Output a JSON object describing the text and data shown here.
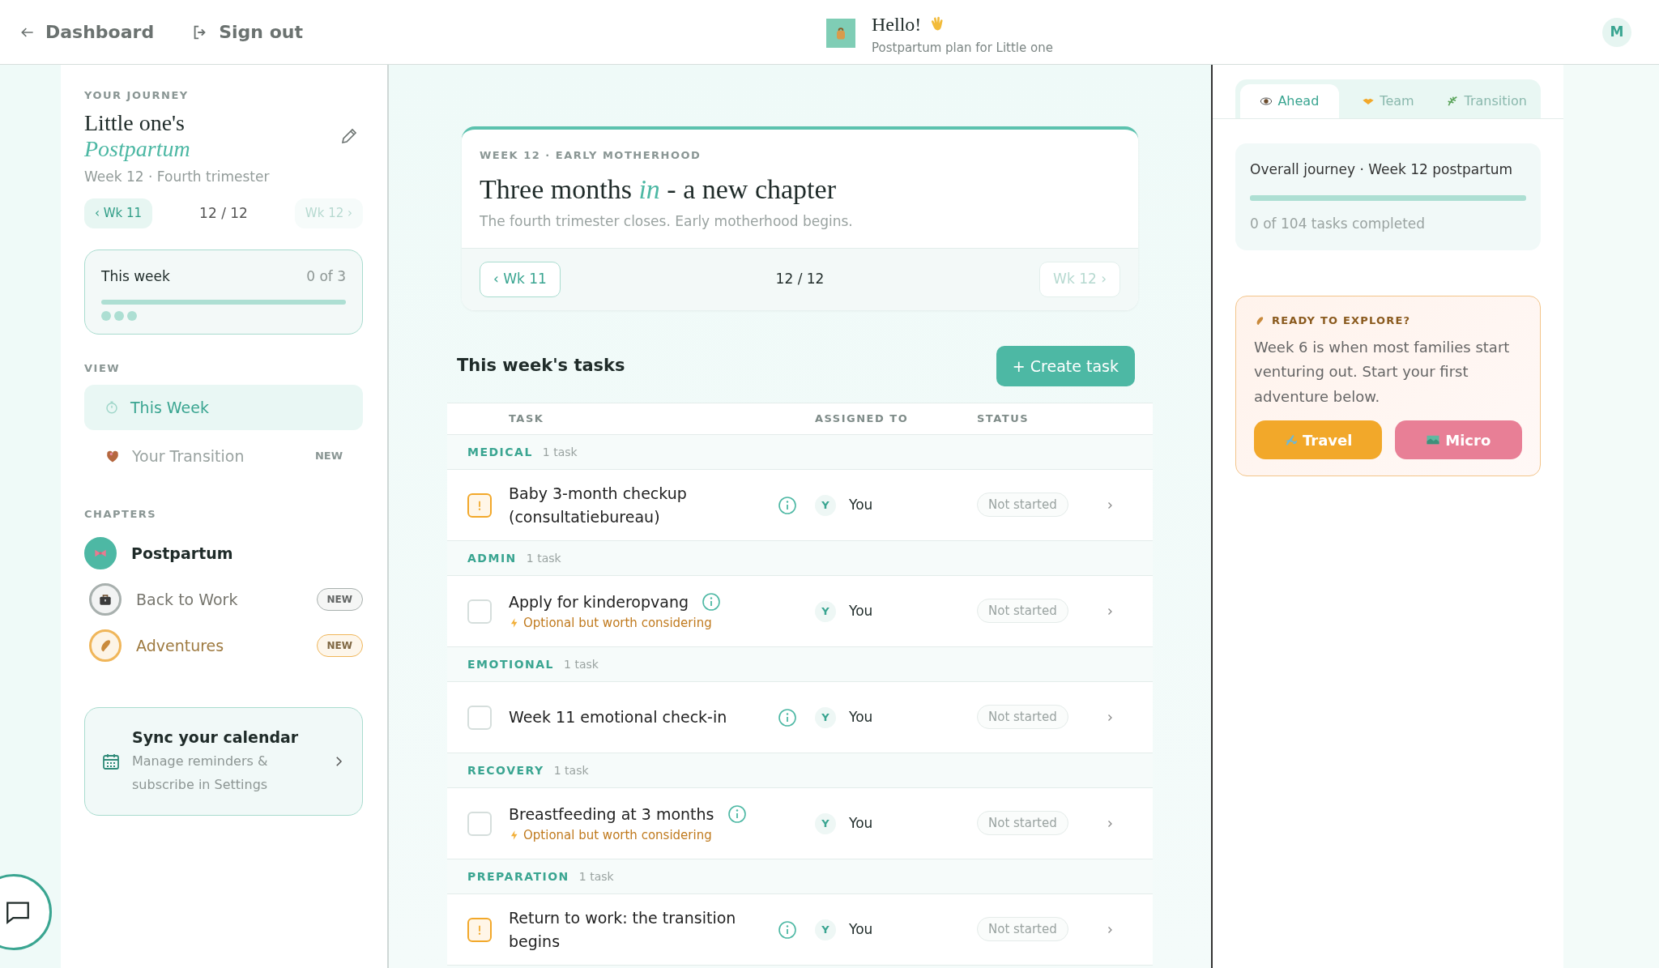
{
  "topbar": {
    "back_label": "Dashboard",
    "signout_label": "Sign out",
    "greeting": "Hello!",
    "subtitle": "Postpartum plan for Little one",
    "avatar_initial": "M"
  },
  "sidebar": {
    "section_label": "YOUR JOURNEY",
    "title": "Little one's",
    "title_accent": "Postpartum",
    "subtitle": "Week 12 · Fourth trimester",
    "prev": {
      "label": "‹ Wk 11",
      "disabled": false
    },
    "counter": "12 / 12",
    "next": {
      "label": "Wk 12 ›",
      "disabled": true
    },
    "this_week": {
      "label": "This week",
      "count": "0 of 3",
      "level": 0,
      "dots": [
        {
          "done": false
        },
        {
          "done": false
        },
        {
          "done": false
        }
      ]
    },
    "view_label": "VIEW",
    "views": [
      {
        "label": "This Week",
        "selected": true
      },
      {
        "label": "Your Transition",
        "selected": false,
        "badge": "NEW"
      }
    ],
    "chapters_label": "CHAPTERS",
    "chapters": [
      {
        "label": "Postpartum",
        "selected": true,
        "color": "#4db8a4"
      },
      {
        "label": "Back to Work",
        "selected": false,
        "badge": "NEW",
        "color": "#a8b0ae"
      },
      {
        "label": "Adventures",
        "selected": false,
        "badge": "NEW",
        "color": "#f0b65a"
      }
    ],
    "calendar": {
      "title": "Sync your calendar",
      "text": "Manage reminders & subscribe in Settings"
    }
  },
  "hero": {
    "eyebrow": "WEEK 12 · EARLY MOTHERHOOD",
    "title": "Three months *in* - a new chapter",
    "subtitle": "The fourth trimester closes. Early motherhood begins.",
    "prev": {
      "label": "‹ Wk 11",
      "disabled": false
    },
    "counter": "12 / 12",
    "next": {
      "label": "Wk 12 ›",
      "disabled": true
    }
  },
  "tasks": {
    "title": "This week's tasks",
    "create_label": "+ Create task",
    "columns": [
      "TASK",
      "ASSIGNED TO",
      "STATUS"
    ],
    "groups": [
      {
        "name": "MEDICAL",
        "count": "1 task",
        "tasks": [
          {
            "kind": "urgent",
            "title": "Baby 3-month checkup (consultatiebureau)",
            "assignee_initial": "Y",
            "assignee": "You",
            "status": "Not started"
          }
        ]
      },
      {
        "name": "ADMIN",
        "count": "1 task",
        "tasks": [
          {
            "kind": "checkbox",
            "checked": false,
            "title": "Apply for kinderopvang",
            "note": "Optional but worth considering",
            "assignee_initial": "Y",
            "assignee": "You",
            "status": "Not started"
          }
        ]
      },
      {
        "name": "EMOTIONAL",
        "count": "1 task",
        "tasks": [
          {
            "kind": "checkbox",
            "checked": false,
            "title": "Week 11 emotional check-in",
            "assignee_initial": "Y",
            "assignee": "You",
            "status": "Not started"
          }
        ]
      },
      {
        "name": "RECOVERY",
        "count": "1 task",
        "tasks": [
          {
            "kind": "checkbox",
            "checked": false,
            "title": "Breastfeeding at 3 months",
            "note": "Optional but worth considering",
            "assignee_initial": "Y",
            "assignee": "You",
            "status": "Not started"
          }
        ]
      },
      {
        "name": "PREPARATION",
        "count": "1 task",
        "tasks": [
          {
            "kind": "urgent",
            "title": "Return to work: the transition begins",
            "assignee_initial": "Y",
            "assignee": "You",
            "status": "Not started"
          }
        ]
      }
    ]
  },
  "right": {
    "tabs": [
      {
        "label": "Ahead",
        "selected": true
      },
      {
        "label": "Team",
        "selected": false
      },
      {
        "label": "Transition",
        "selected": false
      }
    ],
    "journey": {
      "title": "Overall journey · Week 12 postpartum",
      "level": 0,
      "text": "0 of 104 tasks completed"
    },
    "explore": {
      "heading": "READY TO EXPLORE?",
      "text": "Week 6 is when most families start venturing out. Start your first adventure below.",
      "buttons": [
        {
          "label": "Travel",
          "color": "#f2a82a"
        },
        {
          "label": "Micro",
          "color": "#e87f96"
        }
      ]
    }
  }
}
